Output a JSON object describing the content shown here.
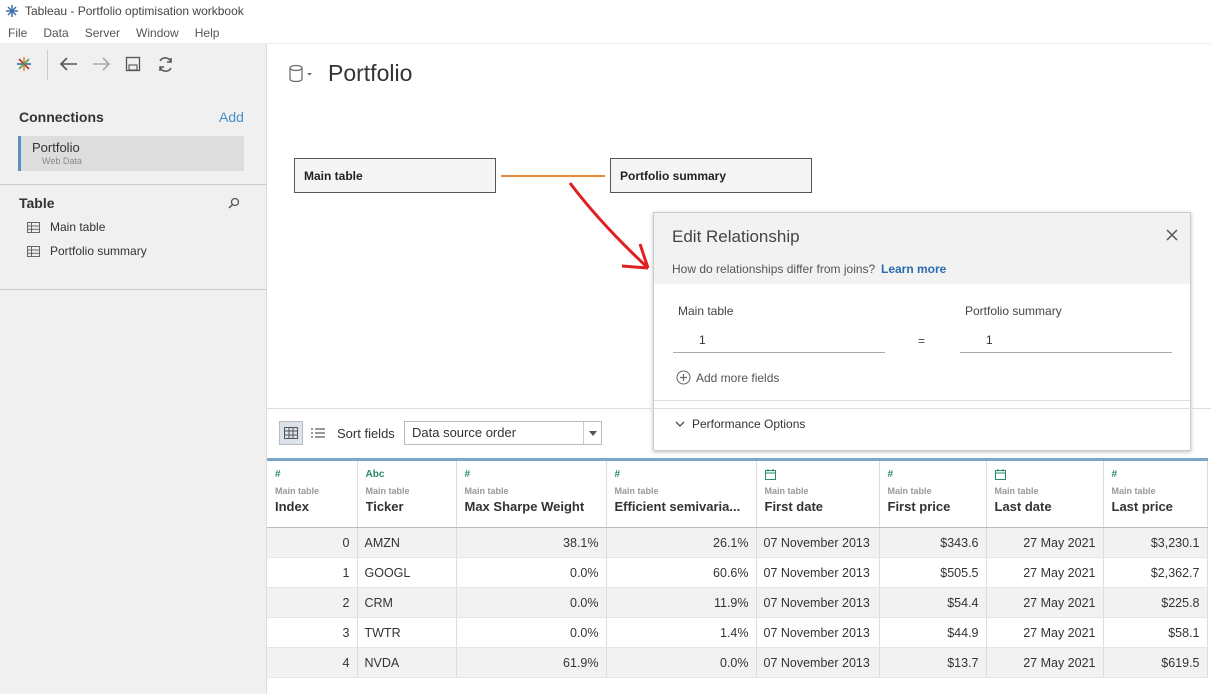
{
  "window": {
    "title": "Tableau - Portfolio optimisation workbook"
  },
  "menu": [
    "File",
    "Data",
    "Server",
    "Window",
    "Help"
  ],
  "connections": {
    "header": "Connections",
    "add_label": "Add",
    "items": [
      {
        "name": "Portfolio",
        "type": "Web Data"
      }
    ]
  },
  "tables": {
    "header": "Table",
    "items": [
      {
        "name": "Main table"
      },
      {
        "name": "Portfolio summary"
      }
    ]
  },
  "datasource": {
    "title": "Portfolio"
  },
  "canvas": {
    "left_table": "Main table",
    "right_table": "Portfolio summary",
    "line_color": "#e8893a"
  },
  "edit_relationship": {
    "title": "Edit Relationship",
    "question": "How do relationships differ from joins?",
    "learn_more": "Learn more",
    "left_label": "Main table",
    "right_label": "Portfolio summary",
    "left_field": "1",
    "right_field": "1",
    "operator": "=",
    "add_more": "Add more fields",
    "performance": "Performance Options"
  },
  "grid_toolbar": {
    "sort_label": "Sort fields",
    "sort_value": "Data source order"
  },
  "data_grid": {
    "columns": [
      {
        "type": "#",
        "source": "Main table",
        "name": "Index"
      },
      {
        "type": "Abc",
        "source": "Main table",
        "name": "Ticker"
      },
      {
        "type": "#",
        "source": "Main table",
        "name": "Max Sharpe Weight"
      },
      {
        "type": "#",
        "source": "Main table",
        "name": "Efficient semivaria..."
      },
      {
        "type": "calendar",
        "source": "Main table",
        "name": "First date"
      },
      {
        "type": "#",
        "source": "Main table",
        "name": "First price"
      },
      {
        "type": "calendar",
        "source": "Main table",
        "name": "Last date"
      },
      {
        "type": "#",
        "source": "Main table",
        "name": "Last price"
      }
    ],
    "rows": [
      [
        "0",
        "AMZN",
        "38.1%",
        "26.1%",
        "07 November 2013",
        "$343.6",
        "27 May 2021",
        "$3,230.1"
      ],
      [
        "1",
        "GOOGL",
        "0.0%",
        "60.6%",
        "07 November 2013",
        "$505.5",
        "27 May 2021",
        "$2,362.7"
      ],
      [
        "2",
        "CRM",
        "0.0%",
        "11.9%",
        "07 November 2013",
        "$54.4",
        "27 May 2021",
        "$225.8"
      ],
      [
        "3",
        "TWTR",
        "0.0%",
        "1.4%",
        "07 November 2013",
        "$44.9",
        "27 May 2021",
        "$58.1"
      ],
      [
        "4",
        "NVDA",
        "61.9%",
        "0.0%",
        "07 November 2013",
        "$13.7",
        "27 May 2021",
        "$619.5"
      ]
    ]
  }
}
